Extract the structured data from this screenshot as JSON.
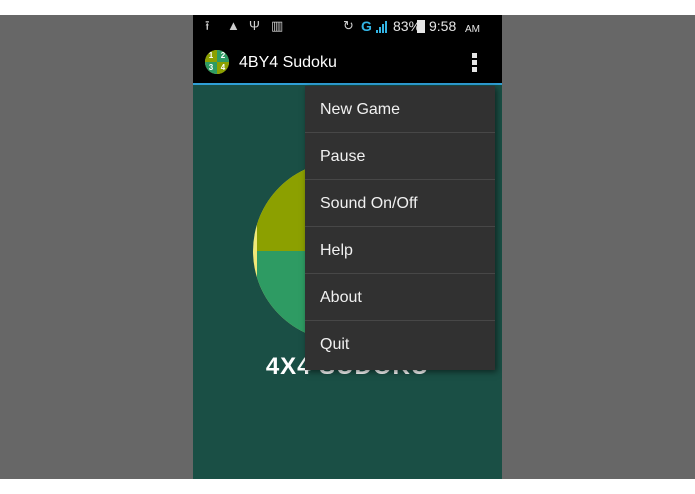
{
  "status_bar": {
    "upload_icon": "upload-icon",
    "warning_icon": "warning-icon",
    "usb_icon": "usb-icon",
    "barcode_icon": "barcode-icon",
    "sync_icon": "sync-icon",
    "network_type": "G",
    "battery_percent": "83%",
    "time": "9:58",
    "ampm": "AM"
  },
  "action_bar": {
    "title": "4BY4 Sudoku",
    "logo_digits": [
      "1",
      "2",
      "3",
      "4"
    ]
  },
  "main": {
    "game_title": "4X4 SUDOKU"
  },
  "menu": {
    "items": [
      {
        "label": "New Game"
      },
      {
        "label": "Pause"
      },
      {
        "label": "Sound On/Off"
      },
      {
        "label": "Help"
      },
      {
        "label": "About"
      },
      {
        "label": "Quit"
      }
    ]
  },
  "colors": {
    "background": "#1a4f45",
    "accent_line": "#2f9fd6",
    "menu_bg": "#313131",
    "wheel_green_dark": "#2e9b63",
    "wheel_green_olive": "#8ca000",
    "wheel_rim": "#f0e978"
  }
}
